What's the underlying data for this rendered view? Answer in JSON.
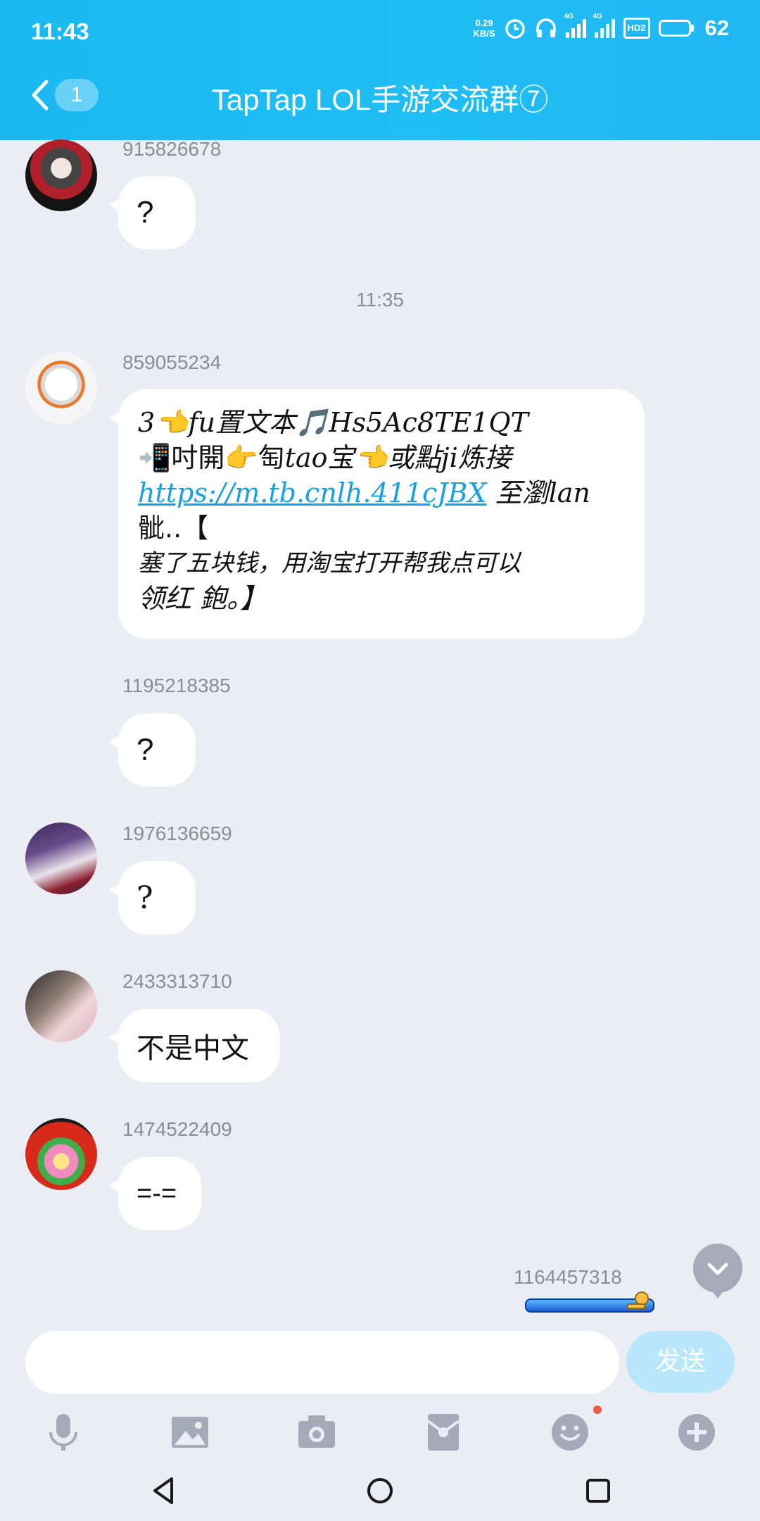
{
  "status_bar": {
    "time": "11:43",
    "net_speed_value": "0.29",
    "net_speed_unit": "KB/S",
    "sim1_tag": "4G",
    "sim2_tag": "4G",
    "hd_label": "HD2",
    "battery": "62"
  },
  "header": {
    "unread_count": "1",
    "title": "TapTap LOL手游交流群⑦"
  },
  "messages": [
    {
      "sender": "915826678",
      "text": "?"
    },
    {
      "timestamp": "11:35"
    },
    {
      "sender": "859055234",
      "lines": [
        {
          "pre": "3👈fu置文本🎵Hs5Ac8TE1QT"
        },
        {
          "pre": "📲",
          "strong": "吋開",
          "mid": "👉",
          "strong2": "匋",
          "post": "tao宝👈或點ji炼接"
        },
        {
          "link": "https://m.tb.cnlh.411cJBX",
          "post": " 至瀏lan"
        },
        {
          "pre": "骴..【"
        },
        {
          "pre": "塞了五块钱，用淘宝打开帮我点可以"
        },
        {
          "pre": "领红 鉋。】"
        }
      ]
    },
    {
      "sender": "1195218385",
      "text": "?"
    },
    {
      "sender": "1976136659",
      "text": "?"
    },
    {
      "sender": "2433313710",
      "text": "不是中文"
    },
    {
      "sender": "1474522409",
      "text": "=-="
    },
    {
      "sender": "1164457318",
      "self": true
    }
  ],
  "input": {
    "placeholder": "",
    "send_label": "发送"
  },
  "toolbar": {
    "icons": [
      "microphone-icon",
      "image-icon",
      "camera-icon",
      "red-packet-icon",
      "emoji-icon",
      "plus-icon"
    ]
  },
  "colors": {
    "header": "#1fbef5",
    "background": "#ebedf5",
    "link": "#16a0e6",
    "send_button": "#b8e6fa"
  }
}
